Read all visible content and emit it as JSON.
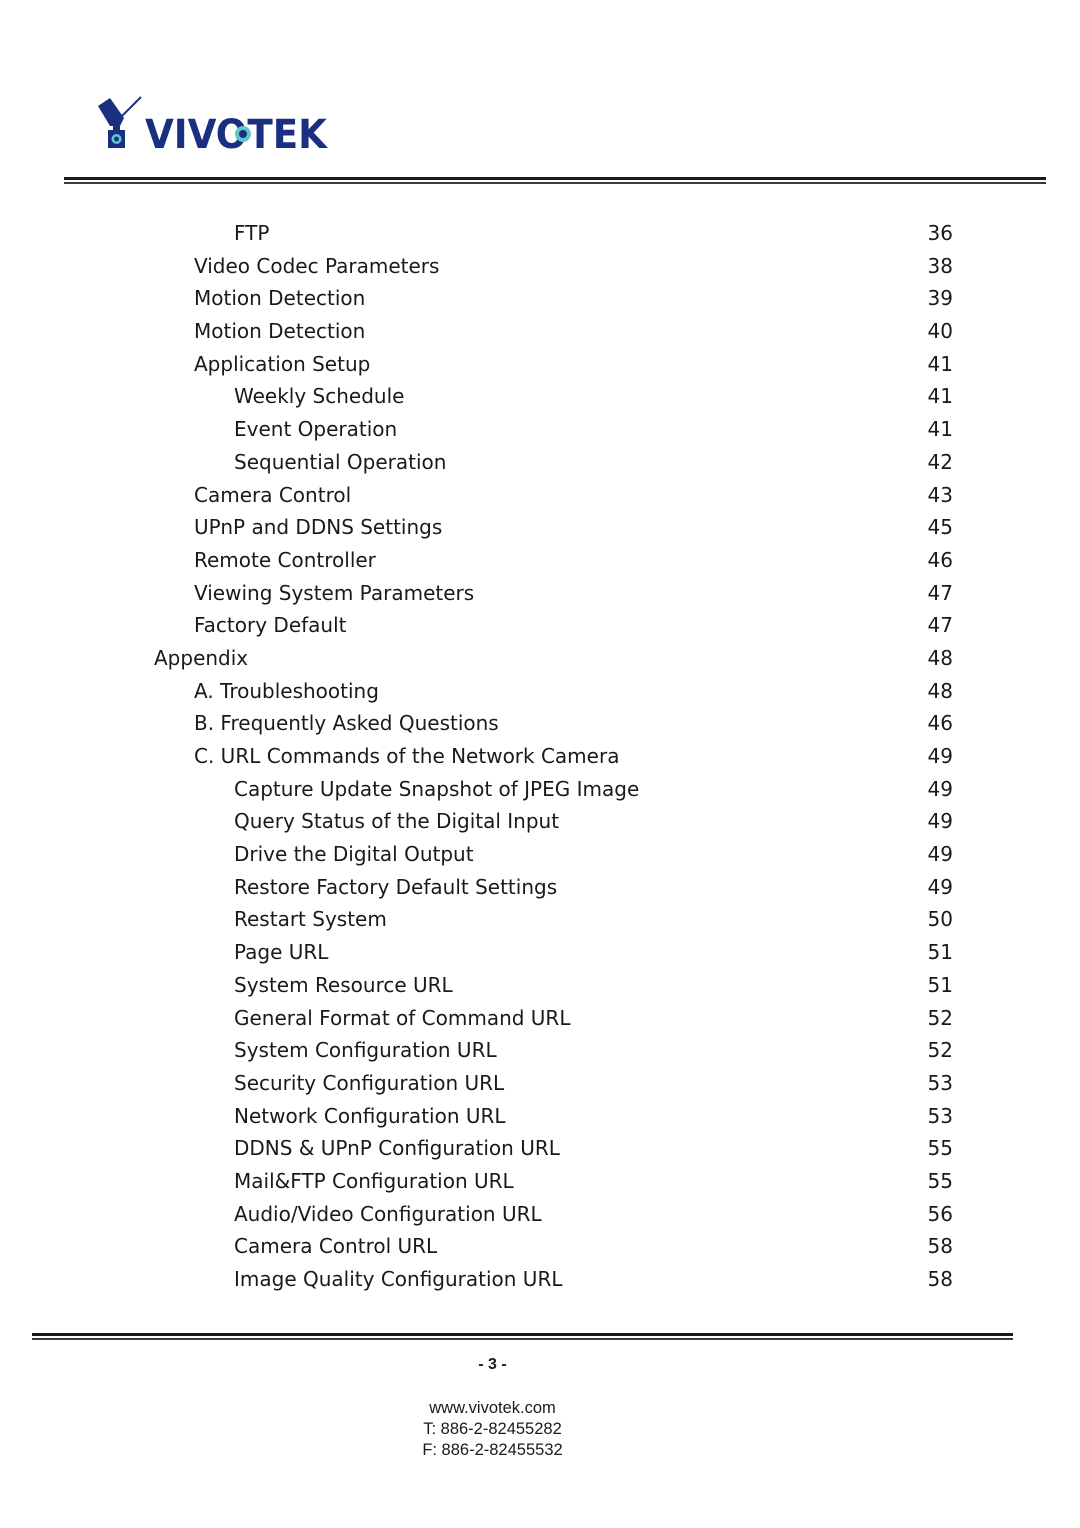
{
  "header": {
    "logo_text": "VIVOTEK",
    "logo_icon": "camera-logo-icon",
    "brand_color": "#1a2f80",
    "accent_color": "#5ec8c8"
  },
  "toc": [
    {
      "level": 2,
      "title": "FTP",
      "page": "36"
    },
    {
      "level": 1,
      "title": "Video Codec Parameters",
      "page": "38"
    },
    {
      "level": 1,
      "title": "Motion Detection",
      "page": "39"
    },
    {
      "level": 1,
      "title": "Motion Detection",
      "page": "40"
    },
    {
      "level": 1,
      "title": "Application Setup",
      "page": "41"
    },
    {
      "level": 2,
      "title": "Weekly Schedule",
      "page": "41"
    },
    {
      "level": 2,
      "title": "Event Operation",
      "page": "41"
    },
    {
      "level": 2,
      "title": "Sequential Operation",
      "page": "42"
    },
    {
      "level": 1,
      "title": "Camera Control",
      "page": "43"
    },
    {
      "level": 1,
      "title": "UPnP and DDNS Settings",
      "page": "45"
    },
    {
      "level": 1,
      "title": "Remote Controller",
      "page": "46"
    },
    {
      "level": 1,
      "title": "Viewing System Parameters",
      "page": "47"
    },
    {
      "level": 1,
      "title": "Factory Default",
      "page": "47"
    },
    {
      "level": 0,
      "title": "Appendix",
      "page": "48"
    },
    {
      "level": 1,
      "title": "A. Troubleshooting",
      "page": "48"
    },
    {
      "level": 1,
      "title": "B. Frequently Asked Questions",
      "page": "46"
    },
    {
      "level": 1,
      "title": "C. URL Commands of the Network Camera",
      "page": "49"
    },
    {
      "level": 2,
      "title": "Capture Update Snapshot of JPEG Image",
      "page": "49"
    },
    {
      "level": 2,
      "title": "Query Status of the Digital Input",
      "page": "49"
    },
    {
      "level": 2,
      "title": "Drive the Digital Output",
      "page": "49"
    },
    {
      "level": 2,
      "title": "Restore Factory Default Settings",
      "page": "49"
    },
    {
      "level": 2,
      "title": "Restart System",
      "page": "50"
    },
    {
      "level": 2,
      "title": "Page URL",
      "page": "51"
    },
    {
      "level": 2,
      "title": "System Resource URL",
      "page": "51"
    },
    {
      "level": 2,
      "title": "General Format of Command URL",
      "page": "52"
    },
    {
      "level": 2,
      "title": "System Configuration URL",
      "page": "52"
    },
    {
      "level": 2,
      "title": "Security Configuration URL",
      "page": "53"
    },
    {
      "level": 2,
      "title": "Network Configuration URL",
      "page": "53"
    },
    {
      "level": 2,
      "title": "DDNS & UPnP Configuration URL",
      "page": "55"
    },
    {
      "level": 2,
      "title": "Mail&FTP Configuration URL",
      "page": "55"
    },
    {
      "level": 2,
      "title": "Audio/Video Configuration URL",
      "page": "56"
    },
    {
      "level": 2,
      "title": "Camera Control URL",
      "page": "58"
    },
    {
      "level": 2,
      "title": "Image Quality Configuration URL",
      "page": "58"
    }
  ],
  "footer": {
    "page_number": "- 3 -",
    "website": "www.vivotek.com",
    "phone": "T: 886-2-82455282",
    "fax": "F: 886-2-82455532"
  }
}
